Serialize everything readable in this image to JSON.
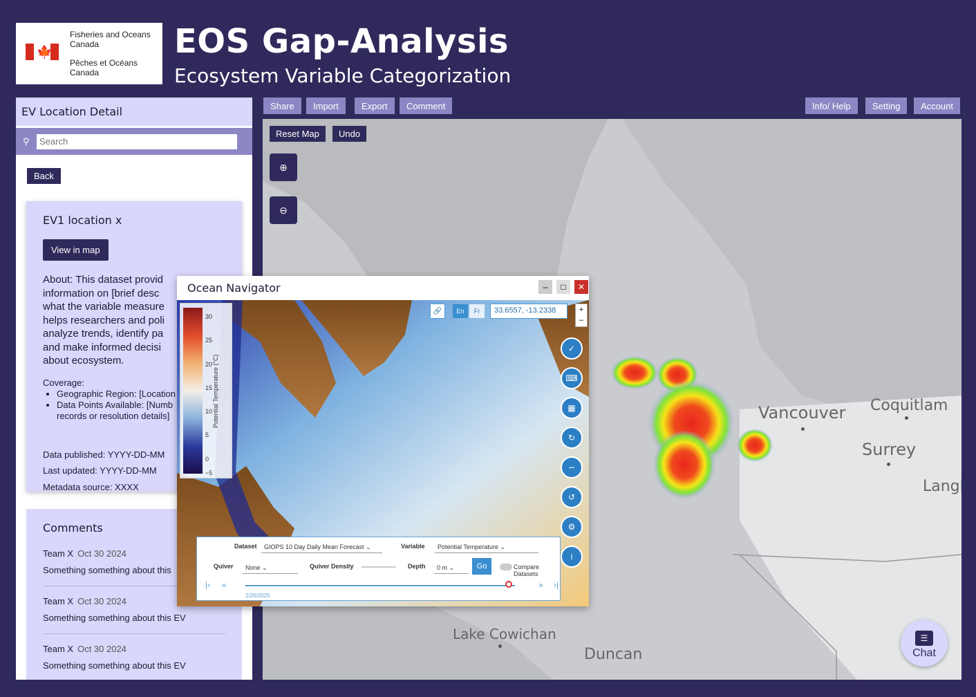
{
  "header": {
    "org_en_line1": "Fisheries and Oceans",
    "org_en_line2": "Canada",
    "org_fr_line1": "Pêches et Océans",
    "org_fr_line2": "Canada",
    "title": "EOS Gap-Analysis",
    "subtitle": "Ecosystem Variable Categorization"
  },
  "sidebar": {
    "title": "EV Location Detail",
    "search_placeholder": "Search",
    "back_label": "Back",
    "detail": {
      "heading": "EV1 location x",
      "view_map_label": "View in map",
      "about_lines": [
        "About: This dataset provid",
        "information on [brief desc",
        "what the variable measure",
        "helps researchers and poli",
        "analyze trends, identify pa",
        "and make informed decisi",
        "about ecosystem."
      ],
      "coverage_label": "Coverage:",
      "coverage_items": [
        "Geographic Region: [Location",
        "Data Points Available: [Numb",
        "records or resolution details]"
      ],
      "published": "Data published: YYYY-DD-MM",
      "updated": "Last updated: YYYY-DD-MM",
      "metadata": "Metadata source: XXXX"
    },
    "comments": {
      "heading": "Comments",
      "items": [
        {
          "author": "Team X",
          "date": "Oct 30 2024",
          "text": "Something something about this"
        },
        {
          "author": "Team X",
          "date": "Oct 30 2024",
          "text": "Something something about this EV"
        },
        {
          "author": "Team X",
          "date": "Oct 30 2024",
          "text": "Something something about this EV"
        }
      ]
    }
  },
  "toolbar": {
    "share": "Share",
    "import": "Import",
    "export": "Export",
    "comment": "Comment",
    "info_help": "Info/ Help",
    "setting": "Setting",
    "account": "Account"
  },
  "map": {
    "reset_label": "Reset Map",
    "undo_label": "Undo",
    "cities": [
      "Vancouver",
      "Coquitlam",
      "Surrey",
      "Langl",
      "Lake Cowichan",
      "Duncan"
    ],
    "chat_label": "Chat"
  },
  "ocean_navigator": {
    "title": "Ocean Navigator",
    "lang_en": "En",
    "lang_fr": "Fr",
    "coords": "33.6557, -13.2338",
    "legend_label": "Potential Temperature (°C)",
    "legend_ticks": [
      "30",
      "25",
      "20",
      "15",
      "10",
      "5",
      "0",
      "−5"
    ],
    "dataset_label": "Dataset",
    "dataset_value": "GIOPS 10 Day Daily Mean Forecast",
    "variable_label": "Variable",
    "variable_value": "Potential Temperature",
    "quiver_label": "Quiver",
    "quiver_value": "None",
    "quiver_density_label": "Quiver Density",
    "depth_label": "Depth",
    "depth_value": "0 m",
    "go_label": "Go",
    "compare_label": "Compare Datasets",
    "timeline_text": "2/26/2025"
  }
}
